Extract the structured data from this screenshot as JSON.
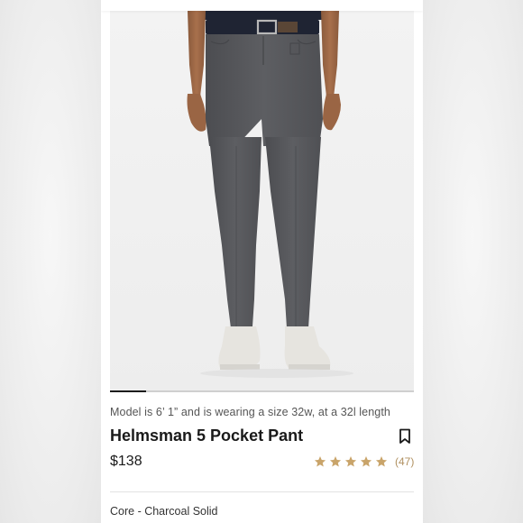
{
  "product": {
    "model_note": "Model is 6’ 1” and is wearing a size 32w, at a 32l length",
    "title": "Helmsman 5 Pocket Pant",
    "price": "$138",
    "rating": {
      "stars": 5,
      "max": 5,
      "review_count": "(47)"
    },
    "variant": "Core - Charcoal Solid"
  },
  "gallery": {
    "progress": 0.12
  },
  "icons": {
    "bookmark": "bookmark-icon",
    "star": "star-icon"
  },
  "colors": {
    "star": "#c9a46a",
    "pant": "#57585c",
    "belt": "#1f2433",
    "progress": "#1c1c1c"
  }
}
